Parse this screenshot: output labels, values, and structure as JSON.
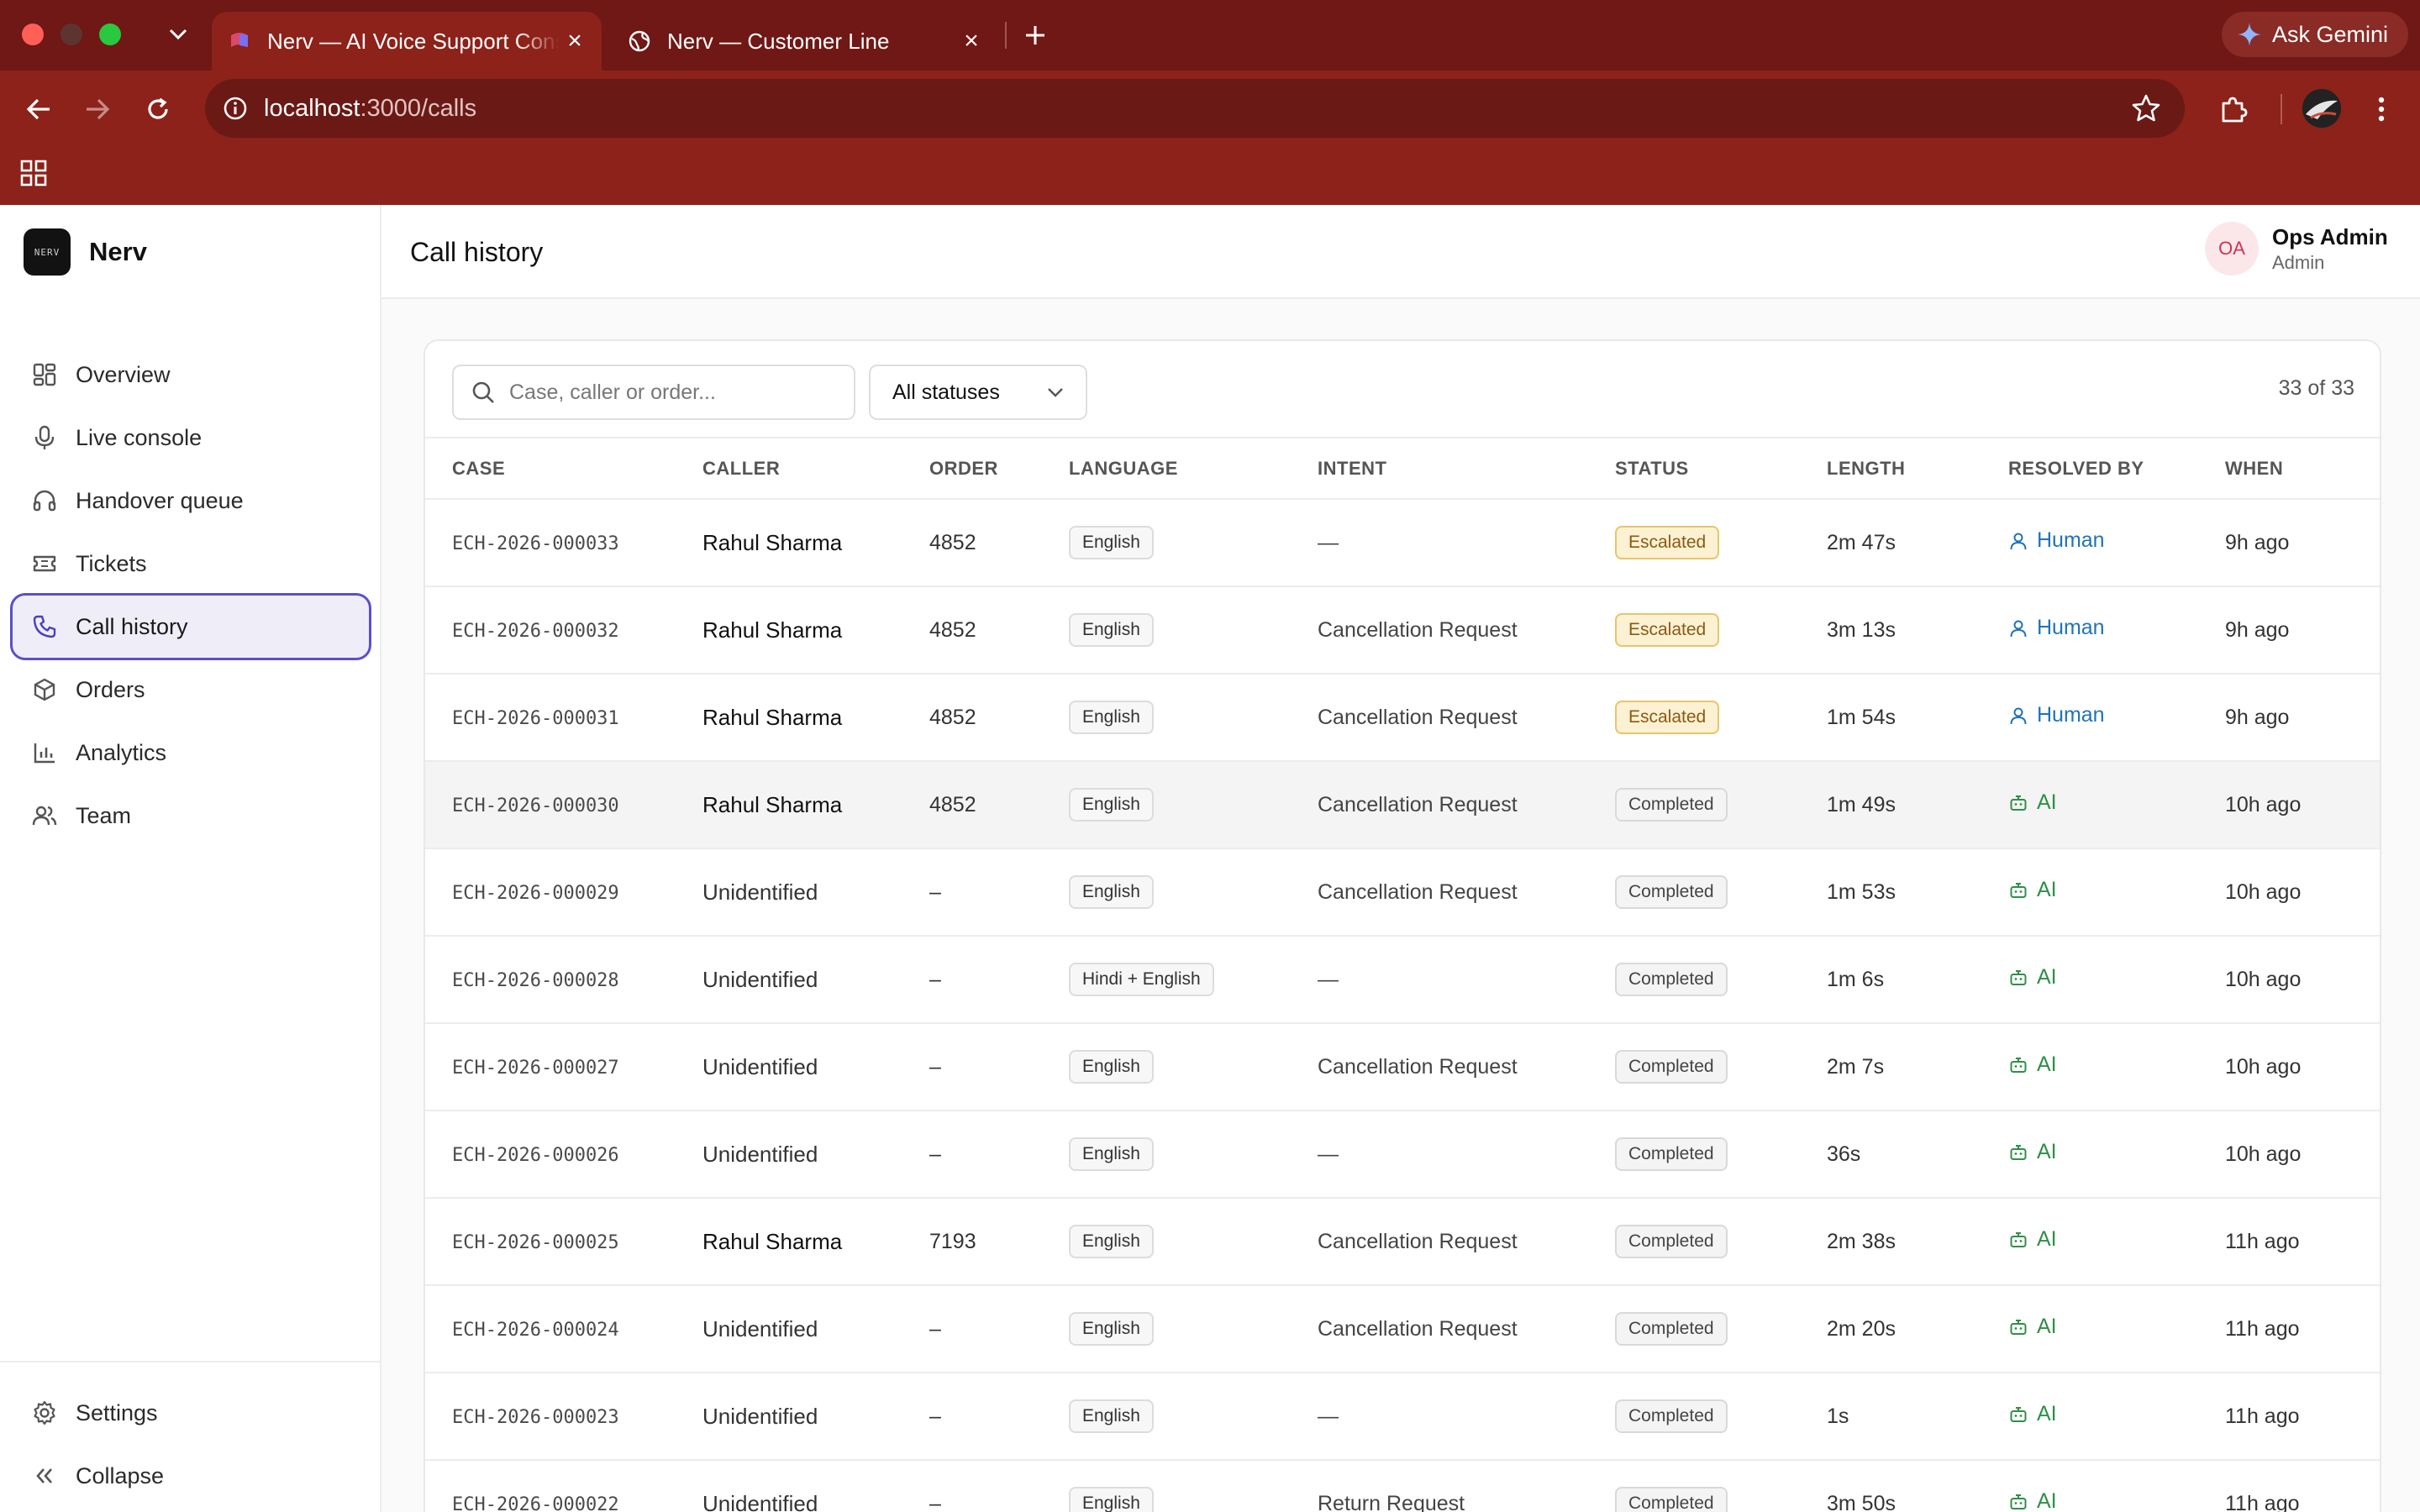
{
  "browser": {
    "tabs": [
      {
        "title": "Nerv — AI Voice Support Console",
        "active": true
      },
      {
        "title": "Nerv — Customer Line",
        "active": false
      }
    ],
    "url_host": "localhost",
    "url_path": ":3000/calls",
    "gemini_label": "Ask Gemini"
  },
  "app": {
    "brand": "Nerv",
    "logo_text": "NERV",
    "nav": [
      {
        "label": "Overview",
        "icon": "grid-icon"
      },
      {
        "label": "Live console",
        "icon": "mic-icon"
      },
      {
        "label": "Handover queue",
        "icon": "headphones-icon"
      },
      {
        "label": "Tickets",
        "icon": "ticket-icon"
      },
      {
        "label": "Call history",
        "icon": "phone-icon",
        "active": true
      },
      {
        "label": "Orders",
        "icon": "box-icon"
      },
      {
        "label": "Analytics",
        "icon": "bar-chart-icon"
      },
      {
        "label": "Team",
        "icon": "users-icon"
      }
    ],
    "footer_nav": [
      {
        "label": "Settings",
        "icon": "gear-icon"
      },
      {
        "label": "Collapse",
        "icon": "chevrons-left-icon"
      }
    ],
    "page_title": "Call history",
    "user": {
      "initials": "OA",
      "name": "Ops Admin",
      "role": "Admin"
    }
  },
  "filters": {
    "search_placeholder": "Case, caller or order...",
    "status_select": "All statuses",
    "count": "33 of 33"
  },
  "table": {
    "columns": [
      "CASE",
      "CALLER",
      "ORDER",
      "LANGUAGE",
      "INTENT",
      "STATUS",
      "LENGTH",
      "RESOLVED BY",
      "WHEN"
    ],
    "rows": [
      {
        "case": "ECH-2026-000033",
        "caller": "Rahul Sharma",
        "order": "4852",
        "language": "English",
        "intent": "—",
        "status": "Escalated",
        "length": "2m 47s",
        "resolved_by": "Human",
        "when": "9h ago"
      },
      {
        "case": "ECH-2026-000032",
        "caller": "Rahul Sharma",
        "order": "4852",
        "language": "English",
        "intent": "Cancellation Request",
        "status": "Escalated",
        "length": "3m 13s",
        "resolved_by": "Human",
        "when": "9h ago"
      },
      {
        "case": "ECH-2026-000031",
        "caller": "Rahul Sharma",
        "order": "4852",
        "language": "English",
        "intent": "Cancellation Request",
        "status": "Escalated",
        "length": "1m 54s",
        "resolved_by": "Human",
        "when": "9h ago"
      },
      {
        "case": "ECH-2026-000030",
        "caller": "Rahul Sharma",
        "order": "4852",
        "language": "English",
        "intent": "Cancellation Request",
        "status": "Completed",
        "length": "1m 49s",
        "resolved_by": "AI",
        "when": "10h ago",
        "hover": true
      },
      {
        "case": "ECH-2026-000029",
        "caller": "Unidentified",
        "order": "–",
        "language": "English",
        "intent": "Cancellation Request",
        "status": "Completed",
        "length": "1m 53s",
        "resolved_by": "AI",
        "when": "10h ago"
      },
      {
        "case": "ECH-2026-000028",
        "caller": "Unidentified",
        "order": "–",
        "language": "Hindi + English",
        "intent": "—",
        "status": "Completed",
        "length": "1m 6s",
        "resolved_by": "AI",
        "when": "10h ago"
      },
      {
        "case": "ECH-2026-000027",
        "caller": "Unidentified",
        "order": "–",
        "language": "English",
        "intent": "Cancellation Request",
        "status": "Completed",
        "length": "2m 7s",
        "resolved_by": "AI",
        "when": "10h ago"
      },
      {
        "case": "ECH-2026-000026",
        "caller": "Unidentified",
        "order": "–",
        "language": "English",
        "intent": "—",
        "status": "Completed",
        "length": "36s",
        "resolved_by": "AI",
        "when": "10h ago"
      },
      {
        "case": "ECH-2026-000025",
        "caller": "Rahul Sharma",
        "order": "7193",
        "language": "English",
        "intent": "Cancellation Request",
        "status": "Completed",
        "length": "2m 38s",
        "resolved_by": "AI",
        "when": "11h ago"
      },
      {
        "case": "ECH-2026-000024",
        "caller": "Unidentified",
        "order": "–",
        "language": "English",
        "intent": "Cancellation Request",
        "status": "Completed",
        "length": "2m 20s",
        "resolved_by": "AI",
        "when": "11h ago"
      },
      {
        "case": "ECH-2026-000023",
        "caller": "Unidentified",
        "order": "–",
        "language": "English",
        "intent": "—",
        "status": "Completed",
        "length": "1s",
        "resolved_by": "AI",
        "when": "11h ago"
      },
      {
        "case": "ECH-2026-000022",
        "caller": "Unidentified",
        "order": "–",
        "language": "English",
        "intent": "Return Request",
        "status": "Completed",
        "length": "3m 50s",
        "resolved_by": "AI",
        "when": "11h ago"
      }
    ]
  },
  "colors": {
    "browser_frame": "#8c2219",
    "accent": "#5a4fcf",
    "human": "#1f73b7",
    "ai": "#2f8f47",
    "escalated": "#fdf1d4"
  }
}
